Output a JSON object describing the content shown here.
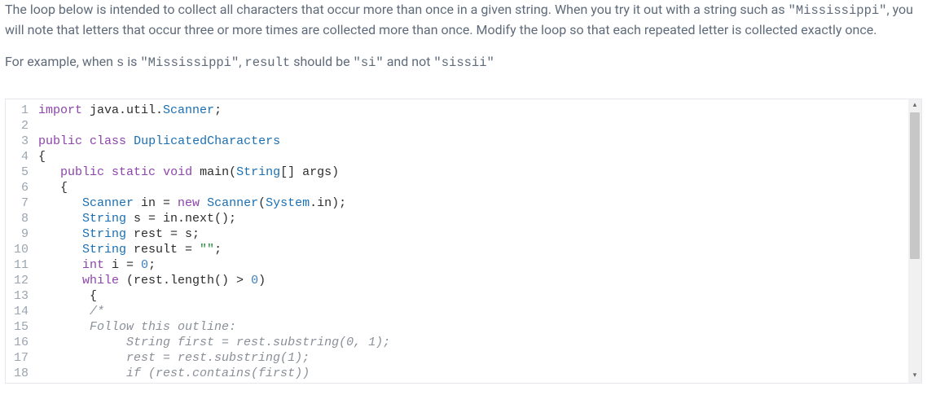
{
  "problem": {
    "para1_parts": {
      "t0": "The loop below is intended to collect all characters that occur more than once in a given string. When you try it out with a string such as ",
      "c0": "\"Mississippi\"",
      "t1": ", you will note that letters that occur three or more times are collected more than once. Modify the loop so that each repeated letter is collected exactly once."
    },
    "para2_parts": {
      "t0": "For example, when ",
      "c0": "s",
      "t1": " is ",
      "c1": "\"Mississippi\"",
      "t2": ", ",
      "c2": "result",
      "t3": " should be ",
      "c3": "\"si\"",
      "t4": " and not ",
      "c4": "\"sissii\""
    }
  },
  "code": {
    "lines": [
      {
        "n": 1,
        "raw": "import java.util.Scanner;",
        "tokens": [
          [
            "kw",
            "import"
          ],
          [
            "plain",
            " java.util."
          ],
          [
            "type",
            "Scanner"
          ],
          [
            "plain",
            ";"
          ]
        ]
      },
      {
        "n": 2,
        "raw": "",
        "tokens": []
      },
      {
        "n": 3,
        "raw": "public class DuplicatedCharacters",
        "tokens": [
          [
            "kw",
            "public"
          ],
          [
            "plain",
            " "
          ],
          [
            "kw",
            "class"
          ],
          [
            "plain",
            " "
          ],
          [
            "type",
            "DuplicatedCharacters"
          ]
        ]
      },
      {
        "n": 4,
        "raw": "{",
        "tokens": [
          [
            "plain",
            "{"
          ]
        ]
      },
      {
        "n": 5,
        "raw": "   public static void main(String[] args)",
        "tokens": [
          [
            "plain",
            "   "
          ],
          [
            "kw",
            "public"
          ],
          [
            "plain",
            " "
          ],
          [
            "kw",
            "static"
          ],
          [
            "plain",
            " "
          ],
          [
            "kw",
            "void"
          ],
          [
            "plain",
            " main("
          ],
          [
            "type",
            "String"
          ],
          [
            "plain",
            "[] args)"
          ]
        ]
      },
      {
        "n": 6,
        "raw": "   {",
        "tokens": [
          [
            "plain",
            "   {"
          ]
        ]
      },
      {
        "n": 7,
        "raw": "      Scanner in = new Scanner(System.in);",
        "tokens": [
          [
            "plain",
            "      "
          ],
          [
            "type",
            "Scanner"
          ],
          [
            "plain",
            " in = "
          ],
          [
            "kw",
            "new"
          ],
          [
            "plain",
            " "
          ],
          [
            "type",
            "Scanner"
          ],
          [
            "plain",
            "("
          ],
          [
            "type",
            "System"
          ],
          [
            "plain",
            ".in);"
          ]
        ]
      },
      {
        "n": 8,
        "raw": "      String s = in.next();",
        "tokens": [
          [
            "plain",
            "      "
          ],
          [
            "type",
            "String"
          ],
          [
            "plain",
            " s = in.next();"
          ]
        ]
      },
      {
        "n": 9,
        "raw": "      String rest = s;",
        "tokens": [
          [
            "plain",
            "      "
          ],
          [
            "type",
            "String"
          ],
          [
            "plain",
            " rest = s;"
          ]
        ]
      },
      {
        "n": 10,
        "raw": "      String result = \"\";",
        "tokens": [
          [
            "plain",
            "      "
          ],
          [
            "type",
            "String"
          ],
          [
            "plain",
            " result = "
          ],
          [
            "str",
            "\"\""
          ],
          [
            "plain",
            ";"
          ]
        ]
      },
      {
        "n": 11,
        "raw": "      int i = 0;",
        "tokens": [
          [
            "plain",
            "      "
          ],
          [
            "kw",
            "int"
          ],
          [
            "plain",
            " i = "
          ],
          [
            "num",
            "0"
          ],
          [
            "plain",
            ";"
          ]
        ]
      },
      {
        "n": 12,
        "raw": "      while (rest.length() > 0)",
        "tokens": [
          [
            "plain",
            "      "
          ],
          [
            "kw",
            "while"
          ],
          [
            "plain",
            " (rest.length() > "
          ],
          [
            "num",
            "0"
          ],
          [
            "plain",
            ")"
          ]
        ]
      },
      {
        "n": 13,
        "raw": "       {",
        "tokens": [
          [
            "plain",
            "       {"
          ]
        ]
      },
      {
        "n": 14,
        "raw": "       /*",
        "tokens": [
          [
            "plain",
            "       "
          ],
          [
            "comment",
            "/*"
          ]
        ]
      },
      {
        "n": 15,
        "raw": "       Follow this outline:",
        "tokens": [
          [
            "plain",
            "       "
          ],
          [
            "comment",
            "Follow this outline:"
          ]
        ]
      },
      {
        "n": 16,
        "raw": "            String first = rest.substring(0, 1);",
        "tokens": [
          [
            "plain",
            "            "
          ],
          [
            "comment",
            "String first = rest.substring(0, 1);"
          ]
        ]
      },
      {
        "n": 17,
        "raw": "            rest = rest.substring(1);",
        "tokens": [
          [
            "plain",
            "            "
          ],
          [
            "comment",
            "rest = rest.substring(1);"
          ]
        ]
      },
      {
        "n": 18,
        "raw": "            if (rest.contains(first))",
        "tokens": [
          [
            "plain",
            "            "
          ],
          [
            "comment",
            "if (rest.contains(first))"
          ]
        ]
      }
    ]
  }
}
